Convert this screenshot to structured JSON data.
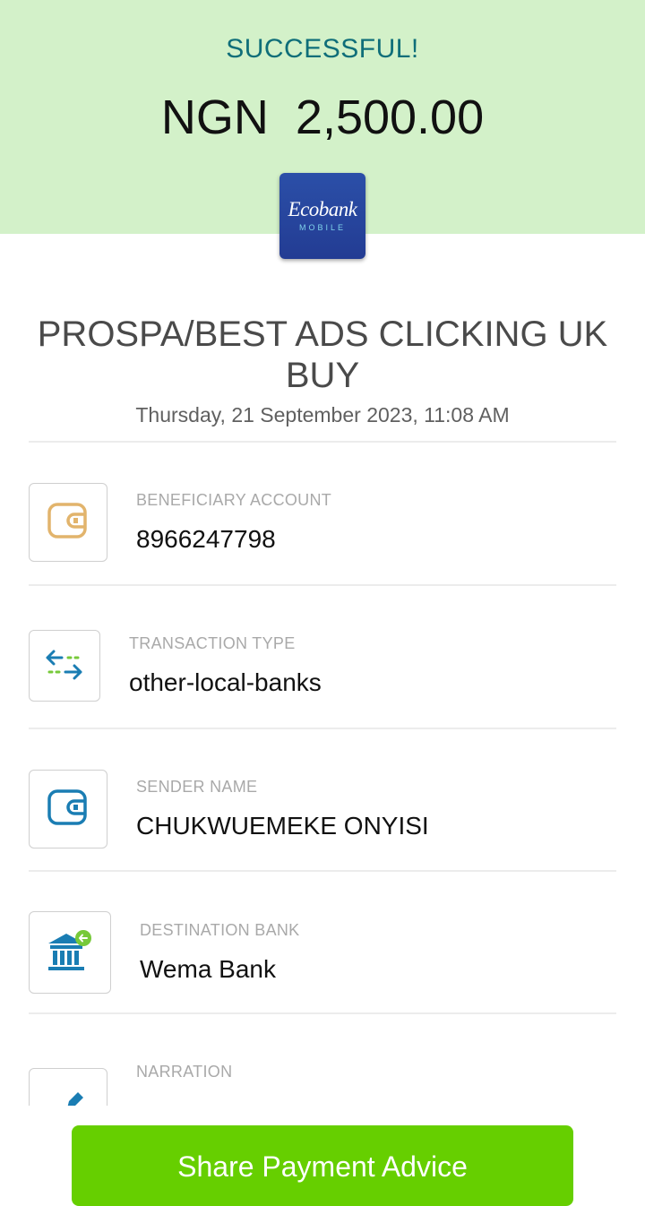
{
  "header": {
    "status": "SUCCESSFUL!",
    "currency": "NGN",
    "amount": "2,500.00",
    "logo": {
      "name": "Ecobank",
      "subtitle": "MOBILE"
    },
    "colors": {
      "background": "#d3f1c9",
      "status": "#0f6e79"
    }
  },
  "transaction": {
    "recipient": "PROSPA/BEST ADS CLICKING UK BUY",
    "datetime": "Thursday, 21 September 2023, 11:08 AM"
  },
  "details": [
    {
      "label": "BENEFICIARY ACCOUNT",
      "value": "8966247798",
      "icon": "wallet-icon"
    },
    {
      "label": "TRANSACTION TYPE",
      "value": "other-local-banks",
      "icon": "transfer-arrows-icon"
    },
    {
      "label": "SENDER NAME",
      "value": "CHUKWUEMEKE ONYISI",
      "icon": "wallet-icon"
    },
    {
      "label": "DESTINATION BANK",
      "value": "Wema Bank",
      "icon": "bank-icon"
    },
    {
      "label": "NARRATION",
      "value": "",
      "icon": "pencil-icon"
    }
  ],
  "actions": {
    "share_label": "Share Payment Advice",
    "color": "#66cf00"
  }
}
